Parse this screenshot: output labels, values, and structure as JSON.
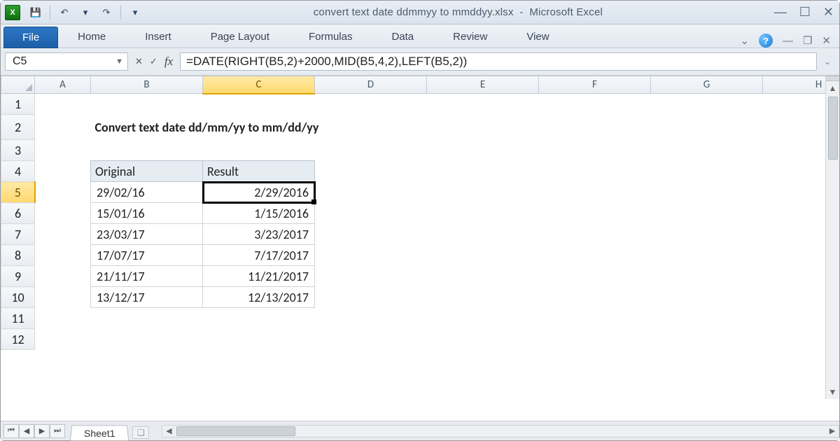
{
  "app": {
    "icon_letter": "X",
    "title_doc": "convert text date ddmmyy to mmddyy.xlsx",
    "title_app": "Microsoft Excel"
  },
  "qat": {
    "save": "💾",
    "undo": "↶",
    "redo": "↷",
    "down": "▾"
  },
  "ribbon": {
    "file": "File",
    "tabs": [
      "Home",
      "Insert",
      "Page Layout",
      "Formulas",
      "Data",
      "Review",
      "View"
    ],
    "help": "?"
  },
  "fbar": {
    "namebox": "C5",
    "fx": "fx",
    "formula": "=DATE(RIGHT(B5,2)+2000,MID(B5,4,2),LEFT(B5,2))"
  },
  "columns": [
    "A",
    "B",
    "C",
    "D",
    "E",
    "F",
    "G",
    "H"
  ],
  "rows": [
    "1",
    "2",
    "3",
    "4",
    "5",
    "6",
    "7",
    "8",
    "9",
    "10",
    "11",
    "12"
  ],
  "selected": {
    "col": "C",
    "row": "5"
  },
  "sheet": {
    "title": "Convert text date dd/mm/yy to mm/dd/yy",
    "headers": {
      "original": "Original",
      "result": "Result"
    },
    "data": [
      {
        "original": "29/02/16",
        "result": "2/29/2016"
      },
      {
        "original": "15/01/16",
        "result": "1/15/2016"
      },
      {
        "original": "23/03/17",
        "result": "3/23/2017"
      },
      {
        "original": "17/07/17",
        "result": "7/17/2017"
      },
      {
        "original": "21/11/17",
        "result": "11/21/2017"
      },
      {
        "original": "13/12/17",
        "result": "12/13/2017"
      }
    ]
  },
  "sheetbar": {
    "tab": "Sheet1"
  }
}
